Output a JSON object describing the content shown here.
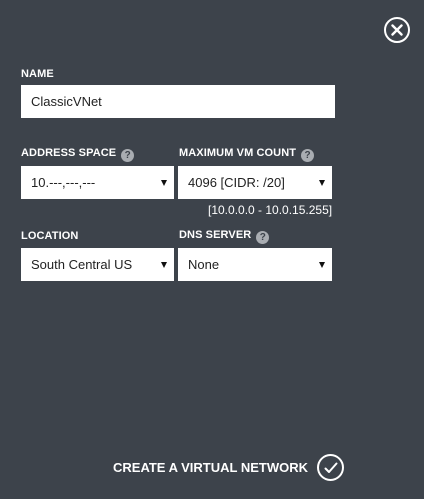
{
  "dialog": {
    "close_icon": "close-icon",
    "name": {
      "label": "NAME",
      "value": "ClassicVNet"
    },
    "address_space": {
      "label": "ADDRESS SPACE",
      "help": "?",
      "selected": "10.---,---,---"
    },
    "max_vm_count": {
      "label": "MAXIMUM VM COUNT",
      "help": "?",
      "selected": "4096 [CIDR: /20]",
      "range": "[10.0.0.0 - 10.0.15.255]"
    },
    "location": {
      "label": "LOCATION",
      "selected": "South Central US"
    },
    "dns_server": {
      "label": "DNS SERVER",
      "help": "?",
      "selected": "None"
    },
    "footer": {
      "label": "CREATE A VIRTUAL NETWORK",
      "icon": "checkmark-icon"
    }
  },
  "colors": {
    "background": "#3d434b",
    "field": "#ffffff",
    "help_badge": "#a9adb2"
  }
}
